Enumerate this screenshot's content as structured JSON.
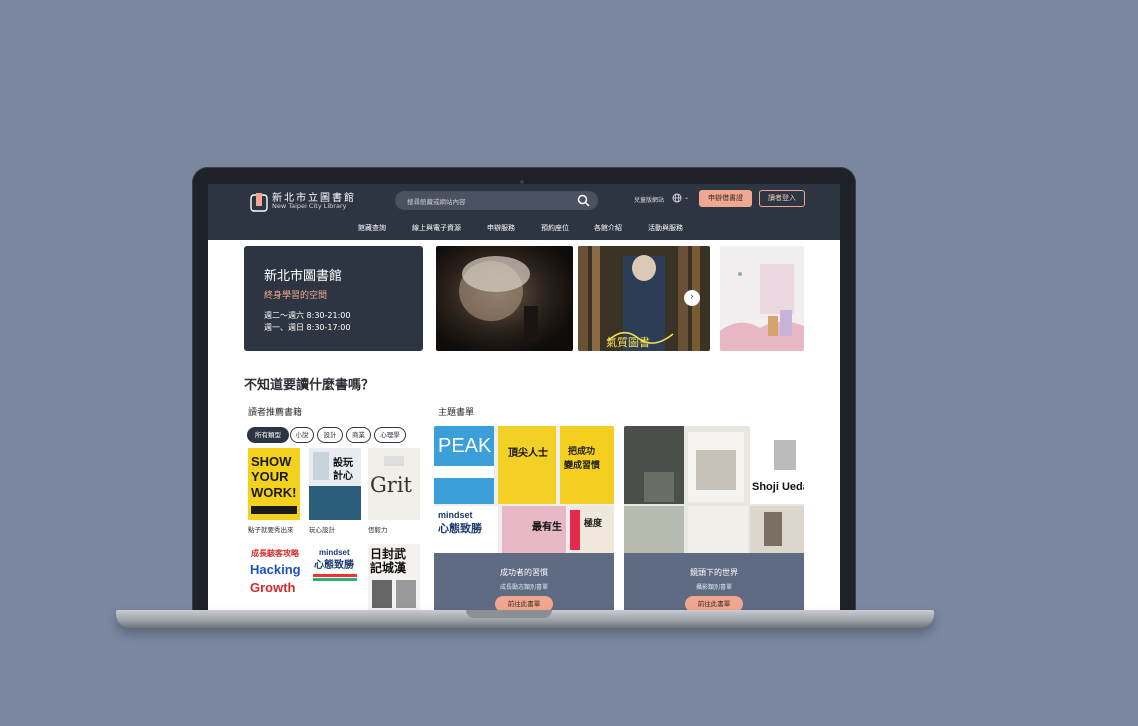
{
  "header": {
    "logo_zh": "新北市立圖書館",
    "logo_en": "New Taipei City Library",
    "search_placeholder": "搜尋館藏或網站內容",
    "kids_link": "兒童版網站",
    "apply_button": "申辦借書證",
    "login_button": "讀者登入"
  },
  "nav": [
    "館藏查詢",
    "線上與電子資源",
    "申辦服務",
    "預約座位",
    "各館介紹",
    "活動與服務"
  ],
  "hero": {
    "title": "新北市圖書館",
    "subtitle": "終身學習的空間",
    "hours_1": "週二～週六 8:30-21:00",
    "hours_2": "週一、週日 8:30-17:00",
    "slide2_text": "氣質圖書"
  },
  "question_title": "不知道要讀什麼書嗎？",
  "reader_section": {
    "title": "讀者推薦書籍",
    "chips": [
      "所有類型",
      "小說",
      "設計",
      "商業",
      "心理學"
    ],
    "books": [
      {
        "caption": "點子就要秀出來",
        "cover": "SHOW YOUR WORK!"
      },
      {
        "caption": "玩心設計",
        "cover": "設玩計心"
      },
      {
        "caption": "恆毅力",
        "cover": "Grit"
      },
      {
        "caption": "",
        "cover": "成長駭客攻略 Hacking Growth"
      },
      {
        "caption": "",
        "cover": "mindset 心態致勝"
      },
      {
        "caption": "",
        "cover": "日記 封城 武漢"
      }
    ]
  },
  "theme_section": {
    "title": "主題書單",
    "lists": [
      {
        "title": "成功者的習慣",
        "subtitle": "成長勵志類別書單",
        "button": "前往此書單",
        "covers": [
          "PEAK",
          "頂尖人士 贏勝心力",
          "把成功變成習慣",
          "mindset 心態致勝",
          "最有生產力的一年",
          "極度專注力 FOCUS"
        ]
      },
      {
        "title": "鏡頭下的世界",
        "subtitle": "攝影類別書單",
        "button": "前往此書單",
        "covers": [
          "Shoji Ueda"
        ]
      }
    ]
  },
  "colors": {
    "bg": "#7a879f",
    "header": "#2e3542",
    "accent": "#f0a68f"
  }
}
